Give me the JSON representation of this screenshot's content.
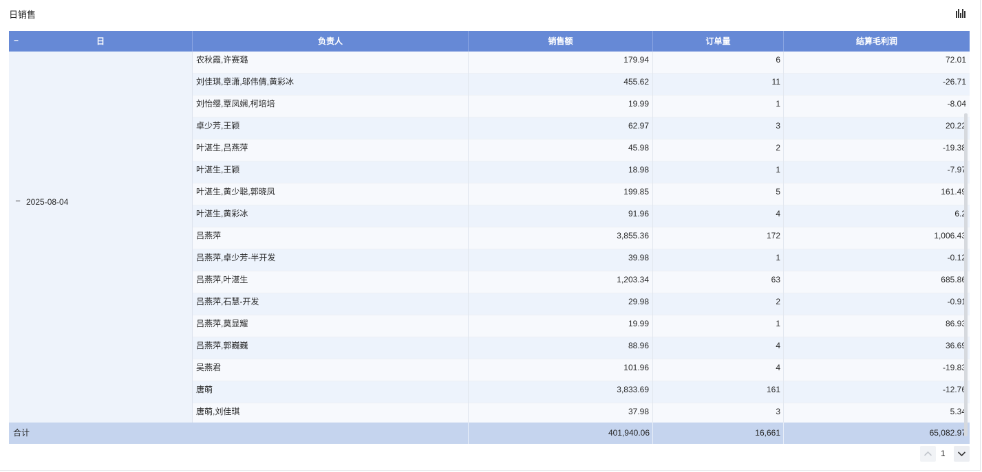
{
  "panel": {
    "title": "日销售",
    "icon": "bar-chart-icon"
  },
  "table": {
    "collapse_all_label": "−",
    "headers": {
      "day": "日",
      "person": "负责人",
      "sales": "销售额",
      "orders": "订单量",
      "profit": "结算毛利润"
    },
    "day_group": {
      "toggle": "−",
      "date": "2025-08-04"
    },
    "rows": [
      {
        "person": "农秋霞,许赛璐",
        "sales": "179.94",
        "orders": "6",
        "profit": "72.01"
      },
      {
        "person": "刘佳琪,章潇,邬伟倩,黄彩冰",
        "sales": "455.62",
        "orders": "11",
        "profit": "-26.71"
      },
      {
        "person": "刘怡缨,覃凤娴,柯培培",
        "sales": "19.99",
        "orders": "1",
        "profit": "-8.04"
      },
      {
        "person": "卓少芳,王颖",
        "sales": "62.97",
        "orders": "3",
        "profit": "20.22"
      },
      {
        "person": "叶湛生,吕燕萍",
        "sales": "45.98",
        "orders": "2",
        "profit": "-19.38"
      },
      {
        "person": "叶湛生,王颖",
        "sales": "18.98",
        "orders": "1",
        "profit": "-7.97"
      },
      {
        "person": "叶湛生,黄少聪,郭晓凤",
        "sales": "199.85",
        "orders": "5",
        "profit": "161.49"
      },
      {
        "person": "叶湛生,黄彩冰",
        "sales": "91.96",
        "orders": "4",
        "profit": "6.2"
      },
      {
        "person": "吕燕萍",
        "sales": "3,855.36",
        "orders": "172",
        "profit": "1,006.43"
      },
      {
        "person": "吕燕萍,卓少芳-半开发",
        "sales": "39.98",
        "orders": "1",
        "profit": "-0.12"
      },
      {
        "person": "吕燕萍,叶湛生",
        "sales": "1,203.34",
        "orders": "63",
        "profit": "685.86"
      },
      {
        "person": "吕燕萍,石慧-开发",
        "sales": "29.98",
        "orders": "2",
        "profit": "-0.91"
      },
      {
        "person": "吕燕萍,莫显耀",
        "sales": "19.99",
        "orders": "1",
        "profit": "86.93"
      },
      {
        "person": "吕燕萍,郭巍巍",
        "sales": "88.96",
        "orders": "4",
        "profit": "36.69"
      },
      {
        "person": "吴燕君",
        "sales": "101.96",
        "orders": "4",
        "profit": "-19.83"
      },
      {
        "person": "唐萌",
        "sales": "3,833.69",
        "orders": "161",
        "profit": "-12.76"
      },
      {
        "person": "唐萌,刘佳琪",
        "sales": "37.98",
        "orders": "3",
        "profit": "5.34"
      }
    ],
    "total": {
      "label": "合计",
      "sales": "401,940.06",
      "orders": "16,661",
      "profit": "65,082.97"
    }
  },
  "pagination": {
    "current_page": "1",
    "prev_icon": "chevron-up-icon",
    "next_icon": "chevron-down-icon"
  }
}
